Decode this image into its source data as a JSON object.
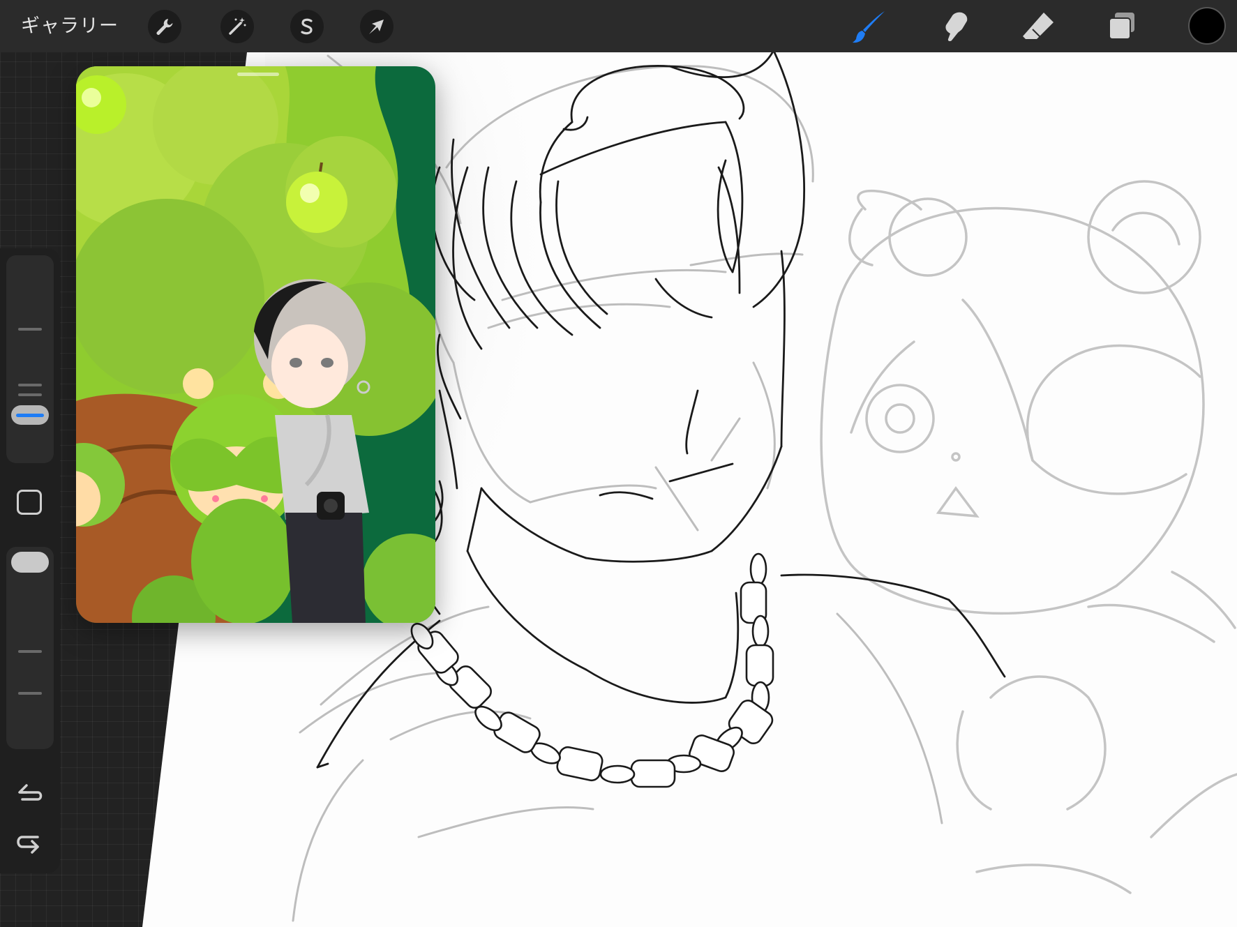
{
  "app": "Procreate",
  "topbar": {
    "gallery_label": "ギャラリー",
    "left_tools": [
      "wrench-icon",
      "magic-wand-icon",
      "selection-icon",
      "transform-arrow-icon"
    ],
    "right_tools": [
      "brush-icon",
      "smudge-icon",
      "eraser-icon",
      "layers-icon"
    ],
    "active_tool": "brush",
    "current_color": "#000000",
    "accent_color": "#1f7df5"
  },
  "sidebar": {
    "controls": [
      "brush-size-slider",
      "modify-button",
      "opacity-slider",
      "undo-button",
      "redo-button"
    ]
  },
  "reference_window": {
    "content": "reference-illustration"
  }
}
